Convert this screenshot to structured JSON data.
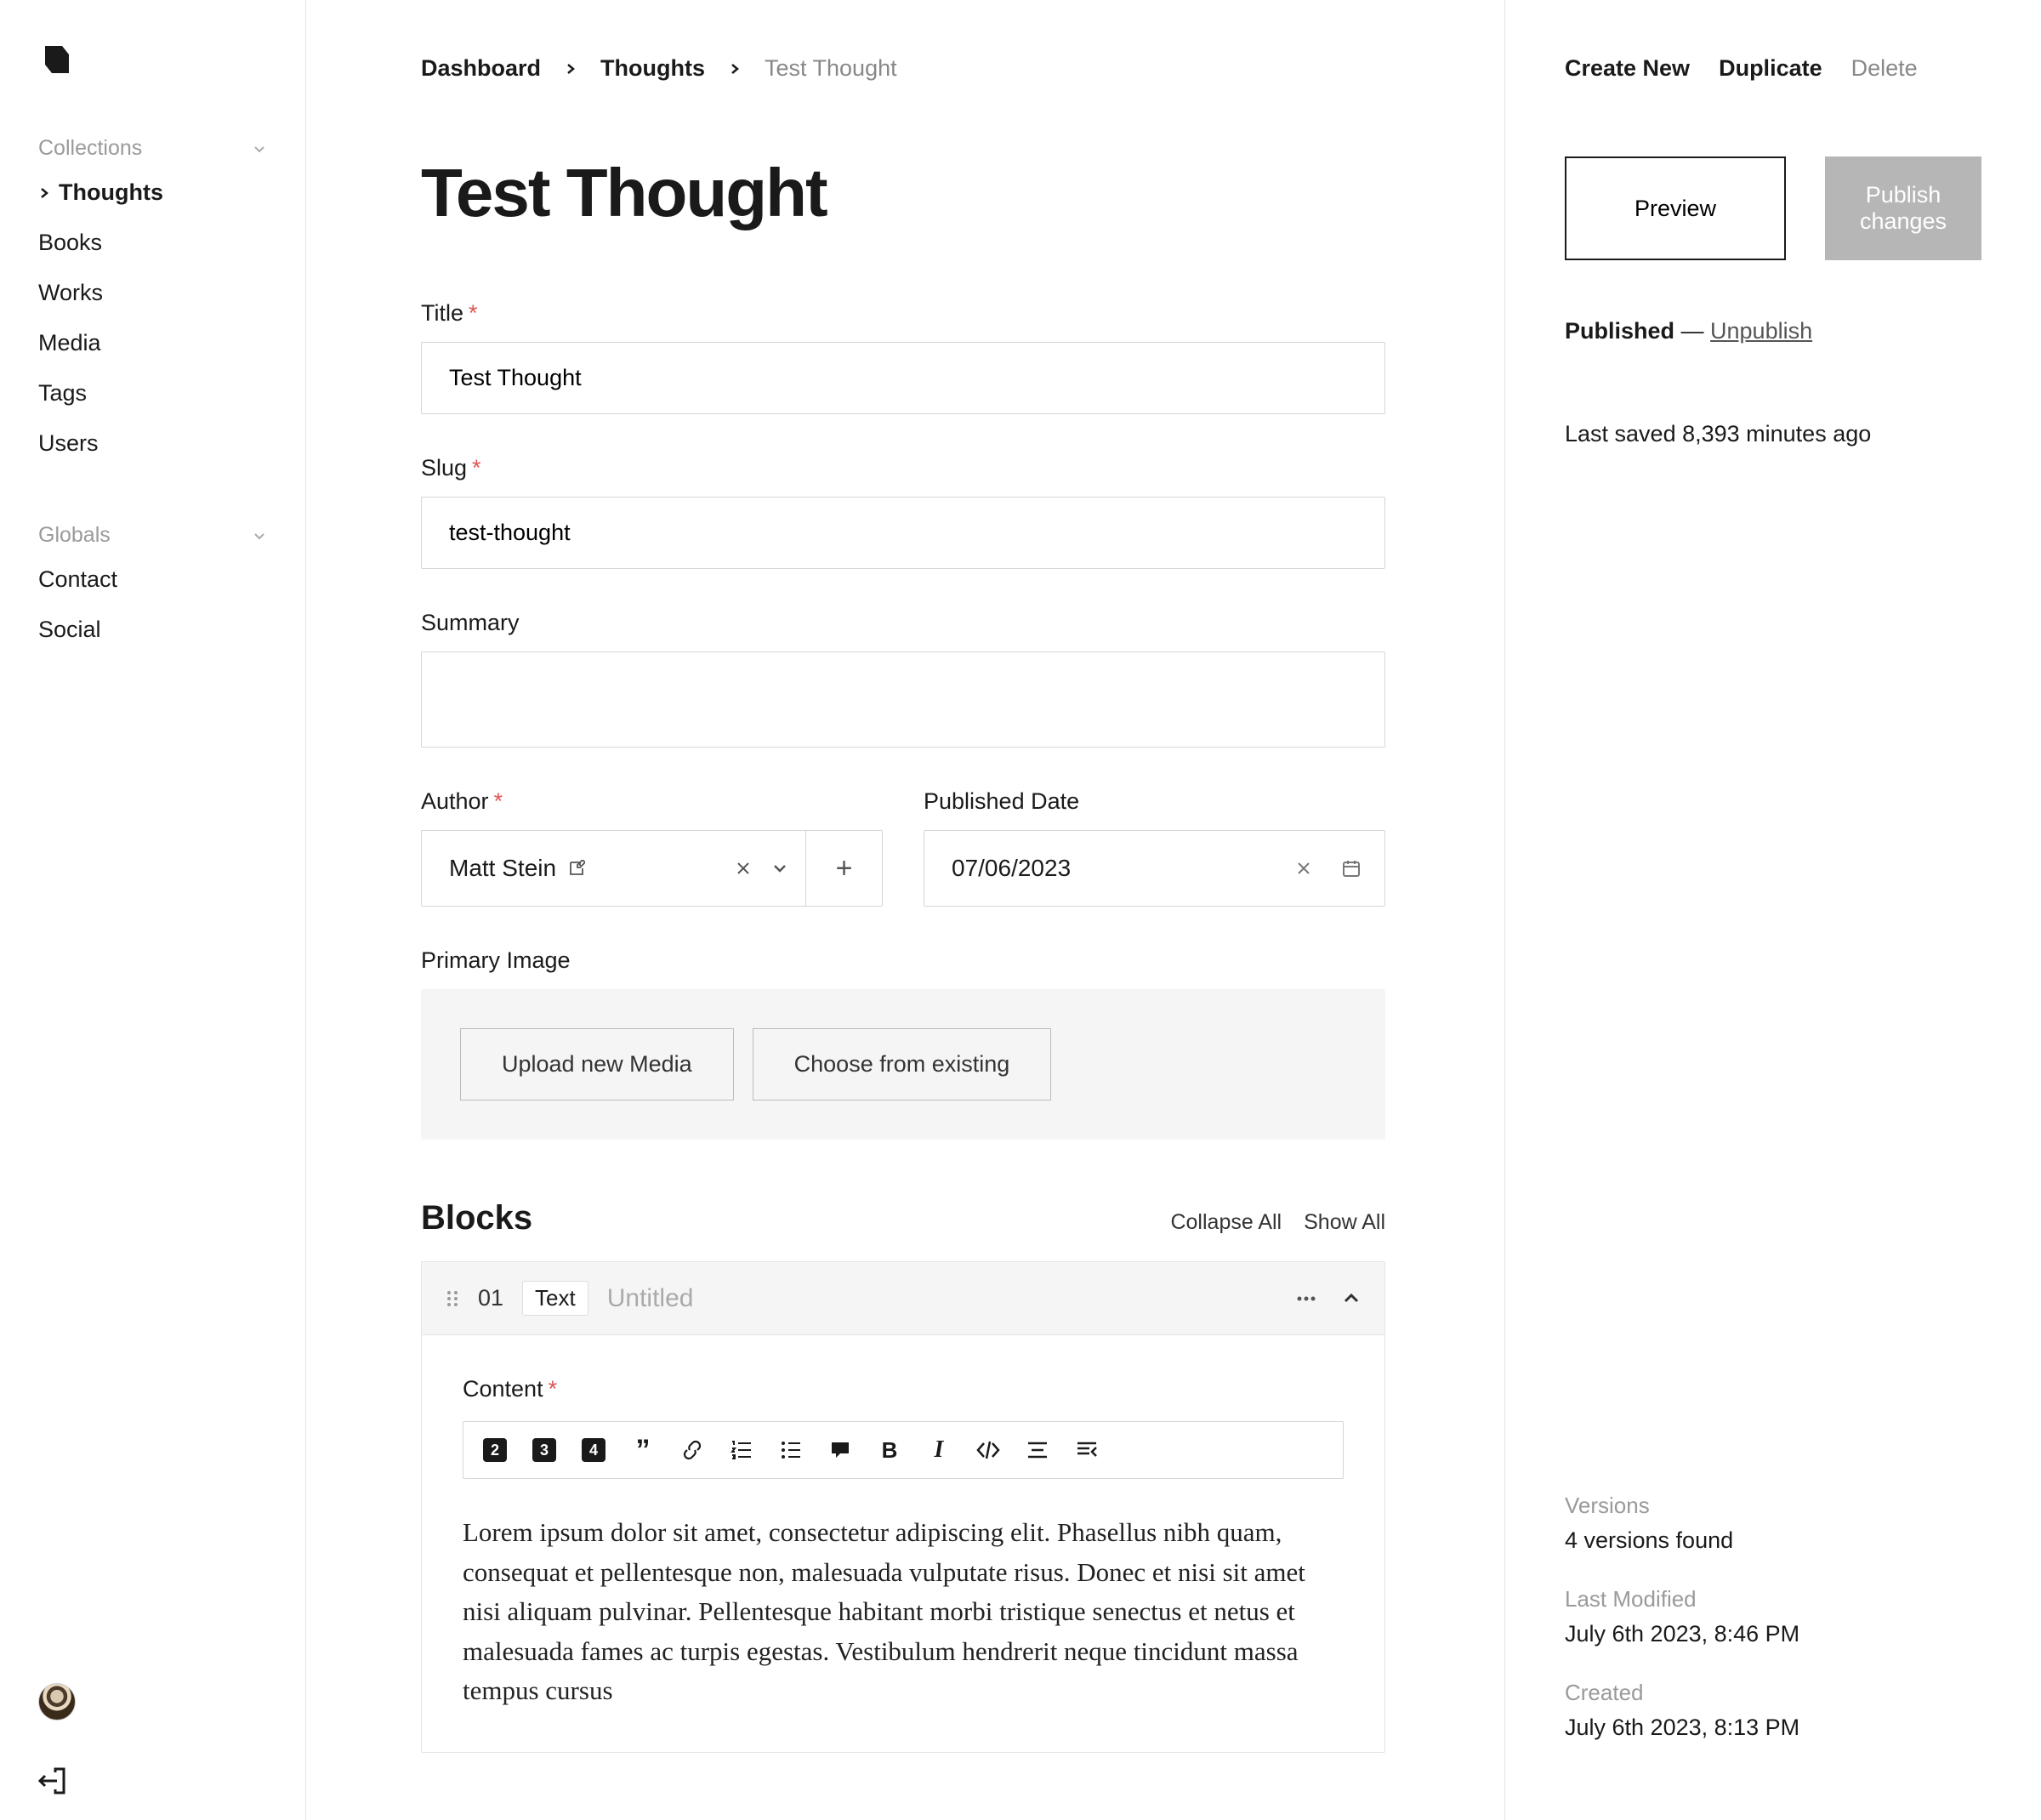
{
  "sidebar": {
    "sections": [
      {
        "label": "Collections",
        "items": [
          "Thoughts",
          "Books",
          "Works",
          "Media",
          "Tags",
          "Users"
        ],
        "activeIndex": 0
      },
      {
        "label": "Globals",
        "items": [
          "Contact",
          "Social"
        ]
      }
    ]
  },
  "breadcrumb": {
    "root": "Dashboard",
    "parent": "Thoughts",
    "current": "Test Thought"
  },
  "page": {
    "title": "Test Thought"
  },
  "fields": {
    "title": {
      "label": "Title",
      "value": "Test Thought"
    },
    "slug": {
      "label": "Slug",
      "value": "test-thought"
    },
    "summary": {
      "label": "Summary",
      "value": ""
    },
    "author": {
      "label": "Author",
      "value": "Matt Stein"
    },
    "publishedDate": {
      "label": "Published Date",
      "value": "07/06/2023"
    },
    "primaryImage": {
      "label": "Primary Image",
      "uploadNew": "Upload new Media",
      "chooseExisting": "Choose from existing"
    }
  },
  "blocks": {
    "heading": "Blocks",
    "collapseAll": "Collapse All",
    "showAll": "Show All",
    "items": [
      {
        "number": "01",
        "type": "Text",
        "name": "Untitled",
        "contentLabel": "Content",
        "content": "Lorem ipsum dolor sit amet, consectetur adipiscing elit. Phasellus nibh quam, consequat et pellentesque non, malesuada vulputate risus. Donec et nisi sit amet nisi aliquam pulvinar. Pellentesque habitant morbi tristique senectus et netus et malesuada fames ac turpis egestas. Vestibulum hendrerit neque tincidunt massa tempus cursus"
      }
    ]
  },
  "actions": {
    "createNew": "Create New",
    "duplicate": "Duplicate",
    "delete": "Delete",
    "preview": "Preview",
    "publishChanges": "Publish changes"
  },
  "status": {
    "published": "Published",
    "sep": " — ",
    "unpublish": "Unpublish",
    "lastSaved": "Last saved 8,393 minutes ago"
  },
  "meta": {
    "versions": {
      "label": "Versions",
      "value": "4 versions found"
    },
    "lastModified": {
      "label": "Last Modified",
      "value": "July 6th 2023, 8:46 PM"
    },
    "created": {
      "label": "Created",
      "value": "July 6th 2023, 8:13 PM"
    }
  },
  "toolbar": {
    "h2": "2",
    "h3": "3",
    "h4": "4"
  }
}
